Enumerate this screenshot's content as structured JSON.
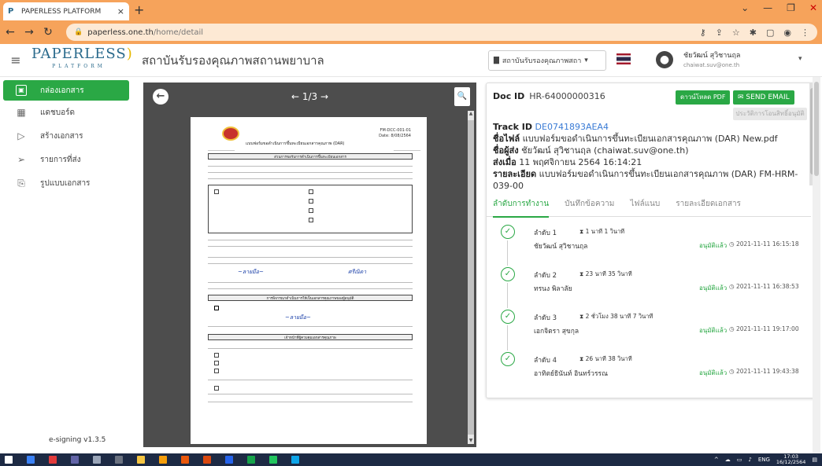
{
  "browser": {
    "tab_title": "PAPERLESS PLATFORM",
    "tab_close": "×",
    "new_tab": "+",
    "url_host": "paperless.one.th",
    "url_path": "/home/detail",
    "win_min": "—",
    "win_max": "❐",
    "win_close": "✕"
  },
  "header": {
    "logo": "PAPERLESS",
    "logo_sub": "PLATFORM",
    "title": "สถาบันรับรองคุณภาพสถานพยาบาล",
    "org_select": "สถาบันรับรองคุณภาพสถา",
    "user_name": "ชัยวัฒน์ สุวิชานฤล",
    "user_email": "chaiwat.suv@one.th"
  },
  "sidebar": {
    "items": [
      {
        "label": "กล่องเอกสาร",
        "icon": "inbox-icon"
      },
      {
        "label": "แดชบอร์ด",
        "icon": "dashboard-icon"
      },
      {
        "label": "สร้างเอกสาร",
        "icon": "create-doc-icon"
      },
      {
        "label": "รายการที่ส่ง",
        "icon": "send-icon"
      },
      {
        "label": "รูปแบบเอกสาร",
        "icon": "template-icon"
      }
    ],
    "version": "e-signing v1.3.5"
  },
  "viewer": {
    "page_indicator": "← 1/3 →",
    "doc_code": "FM-DCC-001-01",
    "doc_date": "Date: 8/08/2564",
    "doc_title": "แบบฟอร์มขอดำเนินการขึ้นทะเบียนเอกสารคุณภาพ (DAR)",
    "box1": "ส่วนการขอรับการดำเนินการขึ้นทะเบียนเอกสาร",
    "box2": "การพิจารณาดำเนินการให้เป็นเอกสารคุณภาพของผู้อนุมัติ",
    "box3": "เจ้าหน้าที่ผู้ควบคุมเอกสารคุณภาพ",
    "signature": "ศรีณิดา"
  },
  "detail": {
    "doc_id_label": "Doc ID",
    "doc_id": "HR-64000000316",
    "download_btn": "ดาวน์โหลด PDF",
    "email_btn": "SEND EMAIL",
    "history_btn": "ประวัติการโอนสิทธิ์อนุมัติ",
    "track_label": "Track ID",
    "track_id": "DE0741893AEA4",
    "file_label": "ชื่อไฟล์",
    "file_name": "แบบฟอร์มขอดำเนินการขึ้นทะเบียนเอกสารคุณภาพ (DAR) New.pdf",
    "sender_label": "ชื่อผู้ส่ง",
    "sender": "ชัยวัฒน์ สุวิชานฤล (chaiwat.suv@one.th)",
    "sent_label": "ส่งเมื่อ",
    "sent_at": "11 พฤศจิกายน 2564 16:14:21",
    "desc_label": "รายละเอียด",
    "desc": "แบบฟอร์มขอดำเนินการขึ้นทะเบียนเอกสารคุณภาพ (DAR) FM-HRM-039-00"
  },
  "tabs": [
    "ลำดับการทำงาน",
    "บันทึกข้อความ",
    "ไฟล์แนบ",
    "รายละเอียดเอกสาร"
  ],
  "steps": [
    {
      "label": "ลำดับ 1",
      "duration": "1 นาที 1 วินาที",
      "who": "ชัยวัฒน์ สุวิชานฤล",
      "status": "อนุมัติแล้ว",
      "time": "2021-11-11 16:15:18"
    },
    {
      "label": "ลำดับ 2",
      "duration": "23 นาที 35 วินาที",
      "who": "ทรนง พิลาลัย",
      "status": "อนุมัติแล้ว",
      "time": "2021-11-11 16:38:53"
    },
    {
      "label": "ลำดับ 3",
      "duration": "2 ชั่วโมง 38 นาที 7 วินาที",
      "who": "เอกจิตรา สุขกุล",
      "status": "อนุมัติแล้ว",
      "time": "2021-11-11 19:17:00"
    },
    {
      "label": "ลำดับ 4",
      "duration": "26 นาที 38 วินาที",
      "who": "อาทิตย์ธินันท์ อินทร์วรรณ",
      "status": "อนุมัติแล้ว",
      "time": "2021-11-11 19:43:38"
    }
  ],
  "taskbar": {
    "lang": "ENG",
    "time": "17:03",
    "date": "16/12/2564"
  },
  "colors": {
    "accent": "#2aa845",
    "browser": "#f6a35b",
    "brand": "#2a6a8c"
  }
}
